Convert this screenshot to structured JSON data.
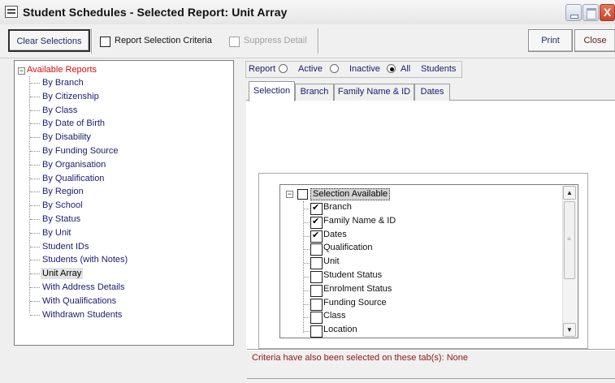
{
  "window": {
    "title": "Student Schedules - Selected Report: Unit Array",
    "close_glyph": "X"
  },
  "toolbar": {
    "clear_selections": "Clear Selections",
    "report_selection_criteria": "Report Selection Criteria",
    "suppress_detail": "Suppress Detail",
    "print": "Print",
    "close": "Close"
  },
  "reports_tree": {
    "expander": "−",
    "root": "Available Reports",
    "items": [
      "By Branch",
      "By Citizenship",
      "By Class",
      "By Date of Birth",
      "By Disability",
      "By Funding Source",
      "By Organisation",
      "By Qualification",
      "By Region",
      "By School",
      "By Status",
      "By Unit",
      "Student IDs",
      "Students (with Notes)",
      "Unit Array",
      "With Address Details",
      "With Qualifications",
      "Withdrawn Students"
    ],
    "selected": "Unit Array"
  },
  "report_filter": {
    "label": "Report",
    "options": [
      "Active",
      "Inactive",
      "All"
    ],
    "selected": "All",
    "suffix": "Students"
  },
  "tabs": [
    "Selection",
    "Branch",
    "Family Name & ID",
    "Dates"
  ],
  "active_tab": "Selection",
  "selection_list": {
    "expander": "−",
    "root": "Selection Available",
    "items": [
      {
        "label": "Branch",
        "checked": true
      },
      {
        "label": "Family Name & ID",
        "checked": true
      },
      {
        "label": "Dates",
        "checked": true
      },
      {
        "label": "Qualification",
        "checked": false
      },
      {
        "label": "Unit",
        "checked": false
      },
      {
        "label": "Student Status",
        "checked": false
      },
      {
        "label": "Enrolment Status",
        "checked": false
      },
      {
        "label": "Funding Source",
        "checked": false
      },
      {
        "label": "Class",
        "checked": false
      },
      {
        "label": "Location",
        "checked": false
      }
    ]
  },
  "scroll_glyphs": {
    "up": "▲",
    "down": "▼",
    "grip": "≡"
  },
  "criteria_note": "Criteria have also been selected on these tab(s): None"
}
